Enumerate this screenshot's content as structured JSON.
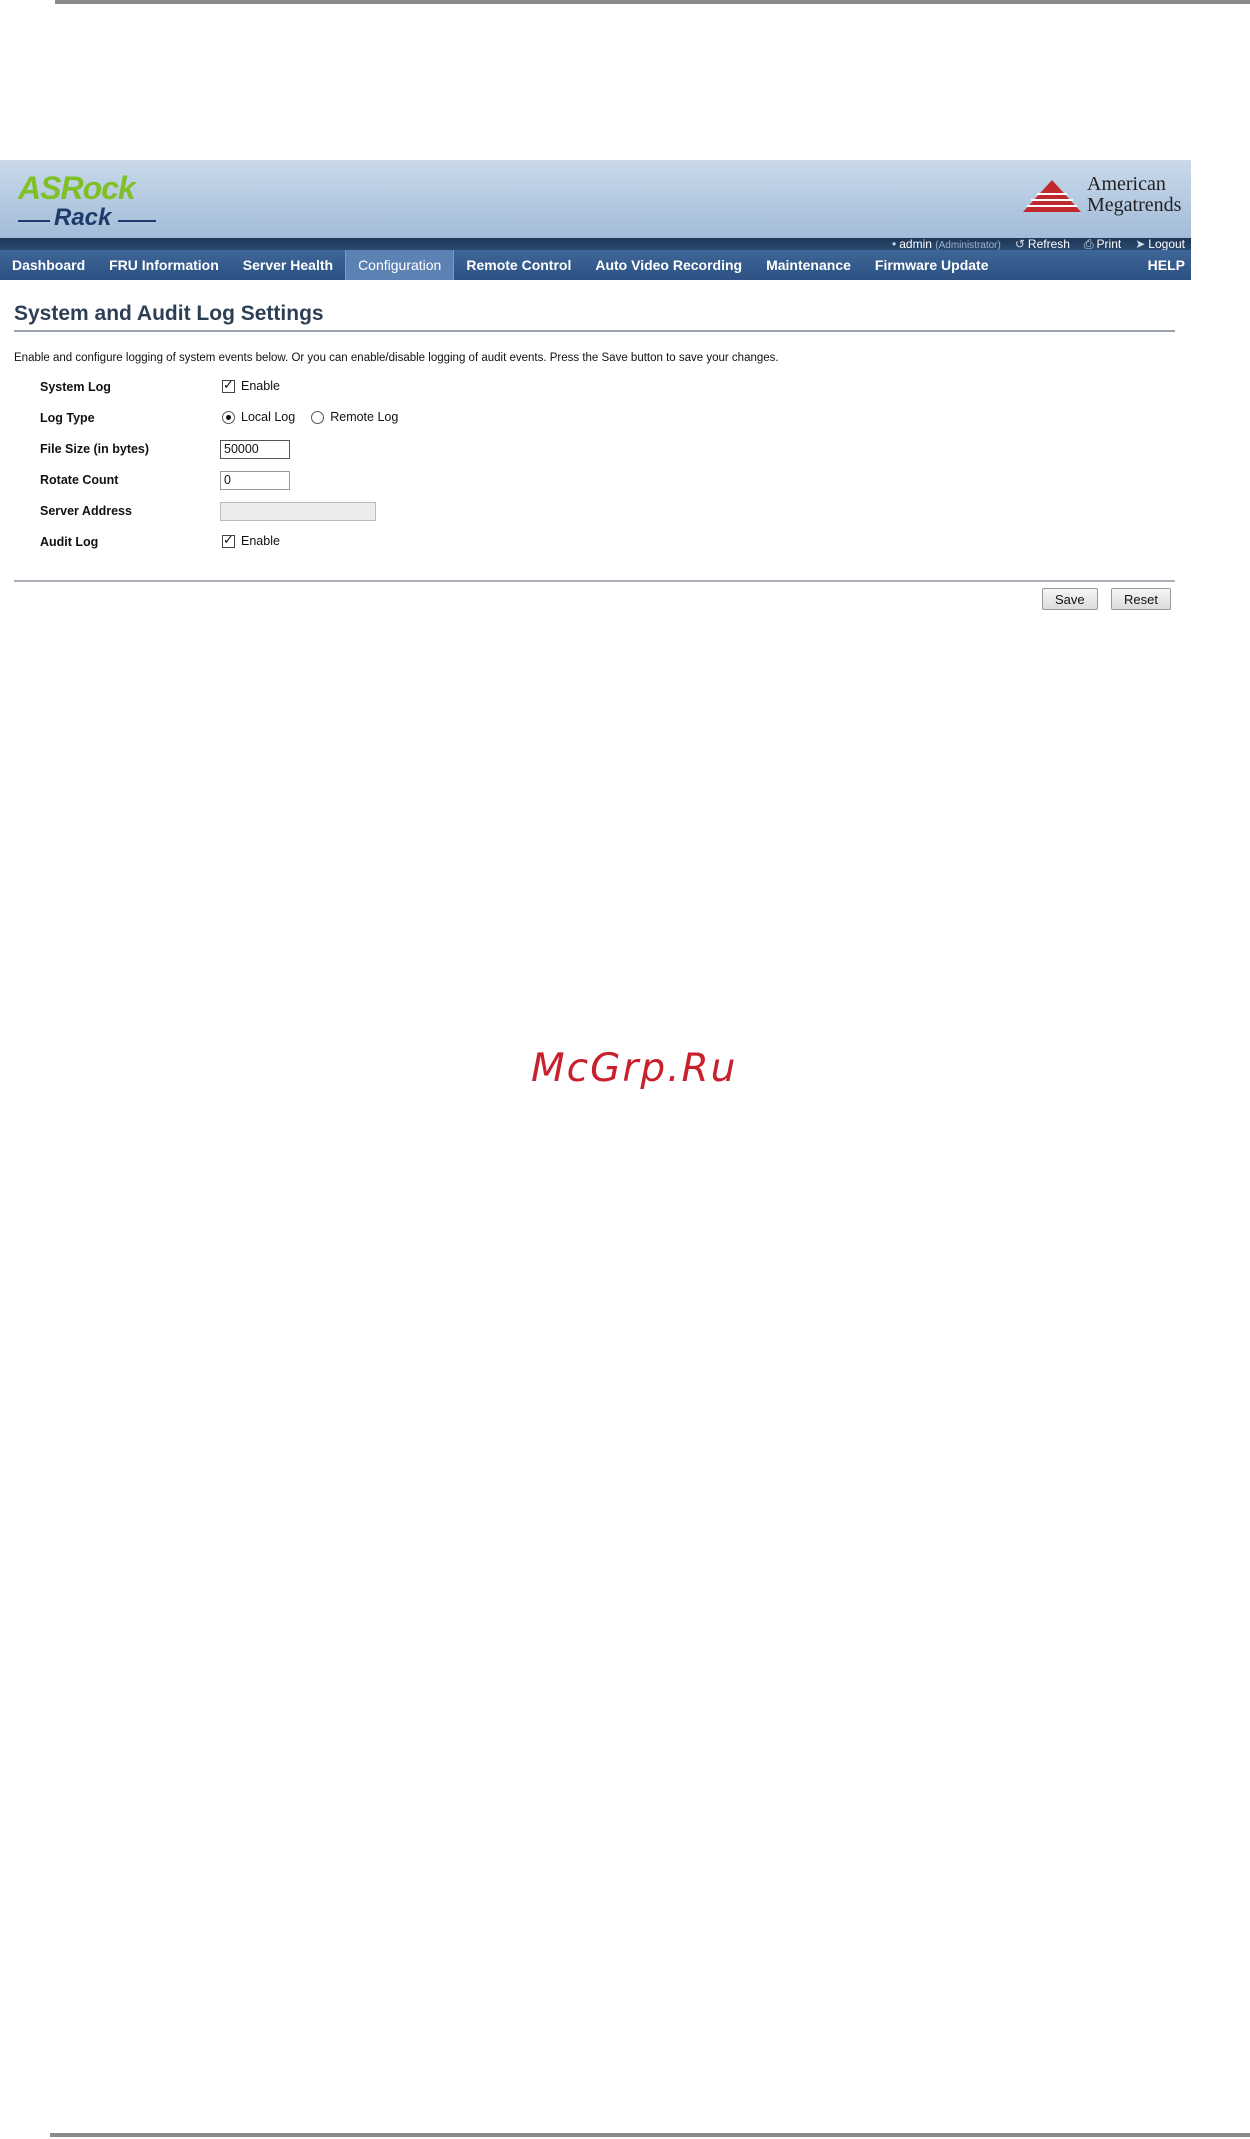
{
  "header": {
    "brand_left_top": "ASRock",
    "brand_left_bottom": "Rack",
    "brand_right_line1": "American",
    "brand_right_line2": "Megatrends"
  },
  "userbar": {
    "user": "admin",
    "role": "(Administrator)",
    "refresh": "Refresh",
    "print": "Print",
    "logout": "Logout"
  },
  "nav": {
    "items": [
      {
        "label": "Dashboard"
      },
      {
        "label": "FRU Information"
      },
      {
        "label": "Server Health"
      },
      {
        "label": "Configuration"
      },
      {
        "label": "Remote Control"
      },
      {
        "label": "Auto Video Recording"
      },
      {
        "label": "Maintenance"
      },
      {
        "label": "Firmware Update"
      }
    ],
    "help": "HELP",
    "active": "Configuration"
  },
  "page": {
    "title": "System and Audit Log Settings",
    "description": "Enable and configure logging of system events below. Or you can enable/disable logging of audit events. Press the Save button to save your changes."
  },
  "form": {
    "system_log_label": "System Log",
    "system_log_option": "Enable",
    "log_type_label": "Log Type",
    "log_type_local": "Local Log",
    "log_type_remote": "Remote Log",
    "file_size_label": "File Size (in bytes)",
    "file_size_value": "50000",
    "rotate_count_label": "Rotate Count",
    "rotate_count_value": "0",
    "server_address_label": "Server Address",
    "server_address_value": "",
    "audit_log_label": "Audit Log",
    "audit_log_option": "Enable"
  },
  "buttons": {
    "save": "Save",
    "reset": "Reset"
  },
  "watermark": "McGrp.Ru"
}
